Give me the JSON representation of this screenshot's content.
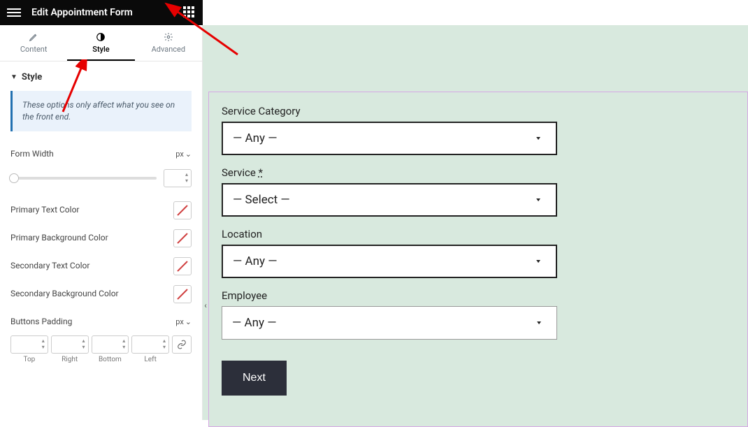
{
  "header": {
    "title": "Edit Appointment Form"
  },
  "tabs": [
    {
      "label": "Content"
    },
    {
      "label": "Style"
    },
    {
      "label": "Advanced"
    }
  ],
  "panel": {
    "section_title": "Style",
    "info_text": "These options only affect what you see on the front end.",
    "form_width_label": "Form Width",
    "unit_px": "px",
    "colors": {
      "primary_text": "Primary Text Color",
      "primary_bg": "Primary Background Color",
      "secondary_text": "Secondary Text Color",
      "secondary_bg": "Secondary Background Color"
    },
    "buttons_padding_label": "Buttons Padding",
    "dims": {
      "top": "Top",
      "right": "Right",
      "bottom": "Bottom",
      "left": "Left"
    }
  },
  "form": {
    "service_category": {
      "label": "Service Category",
      "value": "— Any —"
    },
    "service": {
      "label": "Service",
      "required": "*",
      "value": "— Select —"
    },
    "location": {
      "label": "Location",
      "value": "— Any —"
    },
    "employee": {
      "label": "Employee",
      "value": "— Any —"
    },
    "next_button": "Next"
  }
}
